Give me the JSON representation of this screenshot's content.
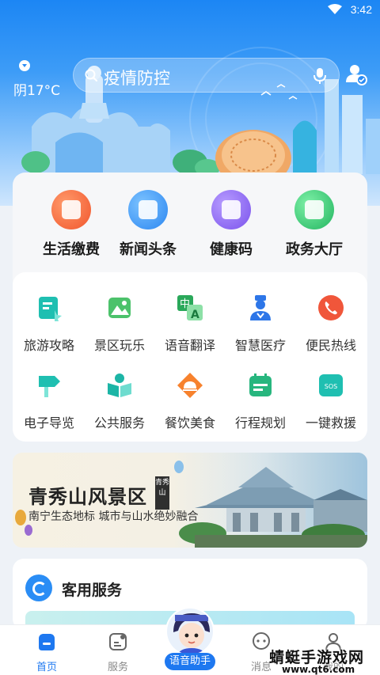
{
  "status_bar": {
    "time": "3:42"
  },
  "header": {
    "weather": "阴17°C",
    "search_text": "疫情防控"
  },
  "top_services": [
    {
      "label": "生活缴费",
      "color": "#fa6a3d",
      "icon": "payment-icon"
    },
    {
      "label": "新闻头条",
      "color": "#3596f7",
      "icon": "news-icon"
    },
    {
      "label": "健康码",
      "color": "#8c67f2",
      "icon": "qrcode-icon"
    },
    {
      "label": "政务大厅",
      "color": "#2ec66c",
      "icon": "government-icon"
    }
  ],
  "grid_services": [
    {
      "label": "旅游攻略",
      "color": "#1fbfb1",
      "icon": "travel-guide-icon"
    },
    {
      "label": "景区玩乐",
      "color": "#4cc26b",
      "icon": "scenic-icon"
    },
    {
      "label": "语音翻译",
      "color": "#2aa85a",
      "icon": "translate-icon",
      "glyph_a": "中",
      "glyph_b": "A"
    },
    {
      "label": "智慧医疗",
      "color": "#2d76e8",
      "icon": "doctor-icon"
    },
    {
      "label": "便民热线",
      "color": "#f0563a",
      "icon": "phone-icon"
    },
    {
      "label": "电子导览",
      "color": "#1fbfb1",
      "icon": "signpost-icon"
    },
    {
      "label": "公共服务",
      "color": "#1cb5a6",
      "icon": "reading-icon"
    },
    {
      "label": "餐饮美食",
      "color": "#f7822d",
      "icon": "dining-icon"
    },
    {
      "label": "行程规划",
      "color": "#27b67e",
      "icon": "calendar-icon"
    },
    {
      "label": "一键救援",
      "color": "#1fbfb1",
      "icon": "sos-icon",
      "glyph": "SOS"
    }
  ],
  "banner": {
    "title": "青秀山风景区",
    "subtitle": "南宁生态地标 城市与山水绝妙融合",
    "seal": "青秀山"
  },
  "service_section": {
    "title": "客用服务"
  },
  "bottom_nav": [
    {
      "label": "首页",
      "active": true,
      "icon": "home-icon"
    },
    {
      "label": "服务",
      "active": false,
      "icon": "service-icon"
    },
    {
      "label": "消息",
      "active": false,
      "icon": "message-icon"
    },
    {
      "label": "我的",
      "active": false,
      "icon": "profile-icon"
    }
  ],
  "assistant": {
    "label": "语音助手"
  },
  "watermark": {
    "title": "蜻蜓手游戏网",
    "url": "www.qt6.com"
  },
  "colors": {
    "primary": "#1e78f0",
    "header_top": "#1c86f4"
  }
}
